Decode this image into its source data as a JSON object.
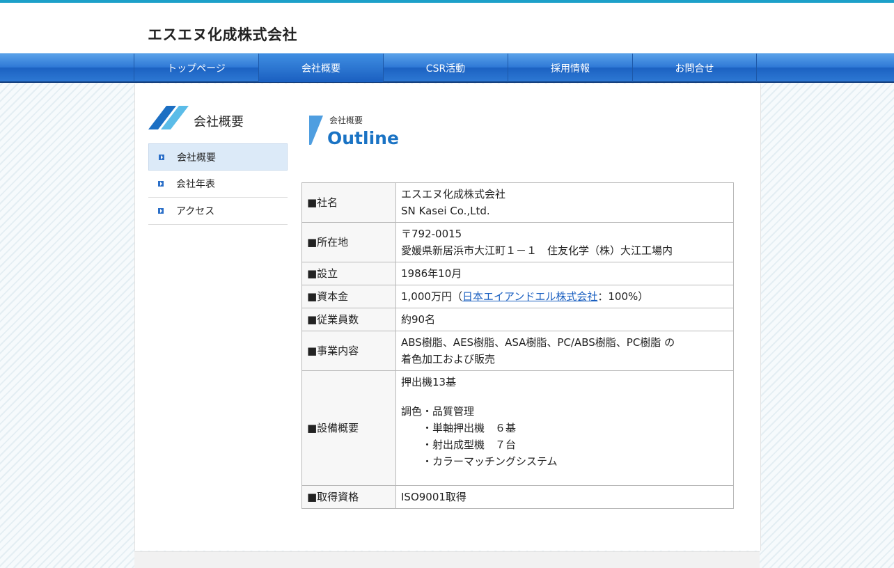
{
  "site": {
    "title": "エスエヌ化成株式会社"
  },
  "nav": {
    "items": [
      {
        "label": "トップページ"
      },
      {
        "label": "会社概要"
      },
      {
        "label": "CSR活動"
      },
      {
        "label": "採用情報"
      },
      {
        "label": "お問合せ"
      }
    ]
  },
  "sidebar": {
    "heading": "会社概要",
    "items": [
      {
        "label": "会社概要"
      },
      {
        "label": "会社年表"
      },
      {
        "label": "アクセス"
      }
    ]
  },
  "page": {
    "subtitle": "会社概要",
    "title": "Outline"
  },
  "outline": {
    "company": {
      "label": "■社名",
      "line1": "エスエヌ化成株式会社",
      "line2": "SN Kasei Co.,Ltd."
    },
    "address": {
      "label": "■所在地",
      "line1": "〒792-0015",
      "line2": "愛媛県新居浜市大江町１－１　住友化学（株）大江工場内"
    },
    "founded": {
      "label": "■設立",
      "value": "1986年10月"
    },
    "capital": {
      "label": "■資本金",
      "prefix": "1,000万円（",
      "link": "日本エイアンドエル株式会社",
      "suffix": "：100%）"
    },
    "employees": {
      "label": "■従業員数",
      "value": "約90名"
    },
    "business": {
      "label": "■事業内容",
      "line1": "ABS樹脂、AES樹脂、ASA樹脂、PC/ABS樹脂、PC樹脂 の",
      "line2": "着色加工および販売"
    },
    "equipment": {
      "label": "■設備概要",
      "line1": "押出機13基",
      "line2": "調色・品質管理",
      "items": [
        "・単軸押出機　６基",
        "・射出成型機　７台",
        "・カラーマッチングシステム"
      ]
    },
    "certification": {
      "label": "■取得資格",
      "value": "ISO9001取得"
    }
  }
}
